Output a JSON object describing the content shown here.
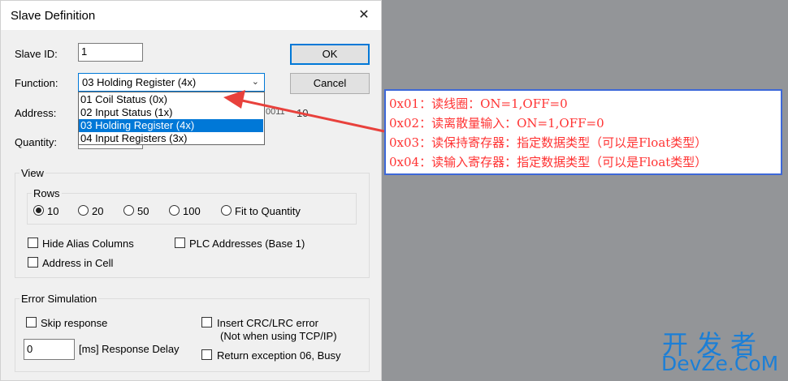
{
  "dialog": {
    "title": "Slave Definition",
    "close_label": "✕"
  },
  "form": {
    "slave_id_label": "Slave ID:",
    "slave_id_value": "1",
    "function_label": "Function:",
    "function_selected": "03 Holding Register (4x)",
    "address_label": "Address:",
    "address_partial": "0011",
    "address_extra": "10",
    "quantity_label": "Quantity:"
  },
  "buttons": {
    "ok": "OK",
    "cancel": "Cancel"
  },
  "function_options": [
    "01 Coil Status (0x)",
    "02 Input Status (1x)",
    "03 Holding Register (4x)",
    "04 Input Registers (3x)"
  ],
  "view": {
    "title": "View",
    "rows_title": "Rows",
    "rows_options": [
      "10",
      "20",
      "50",
      "100",
      "Fit to Quantity"
    ],
    "rows_selected": "10",
    "hide_alias": "Hide Alias Columns",
    "plc_addresses": "PLC Addresses (Base 1)",
    "address_in_cell": "Address in Cell"
  },
  "error_sim": {
    "title": "Error Simulation",
    "skip_response": "Skip response",
    "insert_crc_line1": "Insert CRC/LRC error",
    "insert_crc_line2": "(Not when using TCP/IP)",
    "delay_value": "0",
    "delay_label": "[ms] Response Delay",
    "return_exception": "Return exception 06, Busy"
  },
  "annotation": {
    "lines": [
      "0x01：读线圈：ON=1,OFF=0",
      "0x02：读离散量输入：ON=1,OFF=0",
      "0x03：读保持寄存器：指定数据类型（可以是Float类型）",
      "0x04：读输入寄存器：指定数据类型（可以是Float类型）"
    ],
    "color": "#ff3333",
    "border_color": "#3d68d8"
  },
  "watermark": {
    "line1": "开发者",
    "line2": "DevZe.CoM"
  },
  "colors": {
    "accent": "#0078d7",
    "arrow": "#e8413c"
  }
}
